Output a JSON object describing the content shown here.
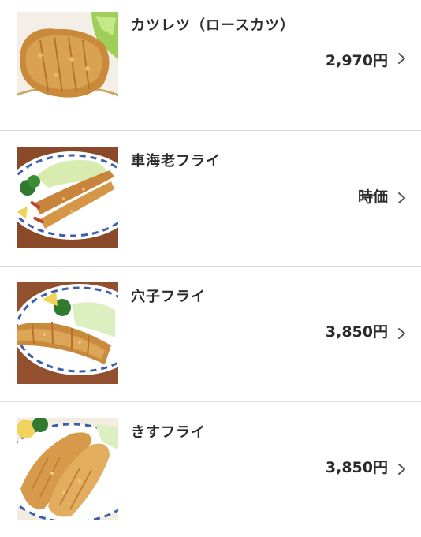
{
  "menu": {
    "items": [
      {
        "name": "カツレツ（ロースカツ）",
        "price": "2,970円",
        "image_icon": "pork-cutlet-photo"
      },
      {
        "name": "車海老フライ",
        "price": "時価",
        "image_icon": "fried-prawn-photo"
      },
      {
        "name": "穴子フライ",
        "price": "3,850円",
        "image_icon": "fried-conger-eel-photo"
      },
      {
        "name": "きすフライ",
        "price": "3,850円",
        "image_icon": "fried-whiting-photo"
      }
    ]
  },
  "colors": {
    "accent": "#d9502b",
    "divider": "#d9d9d9",
    "text": "#2b2b2b",
    "chevron": "#555555"
  }
}
